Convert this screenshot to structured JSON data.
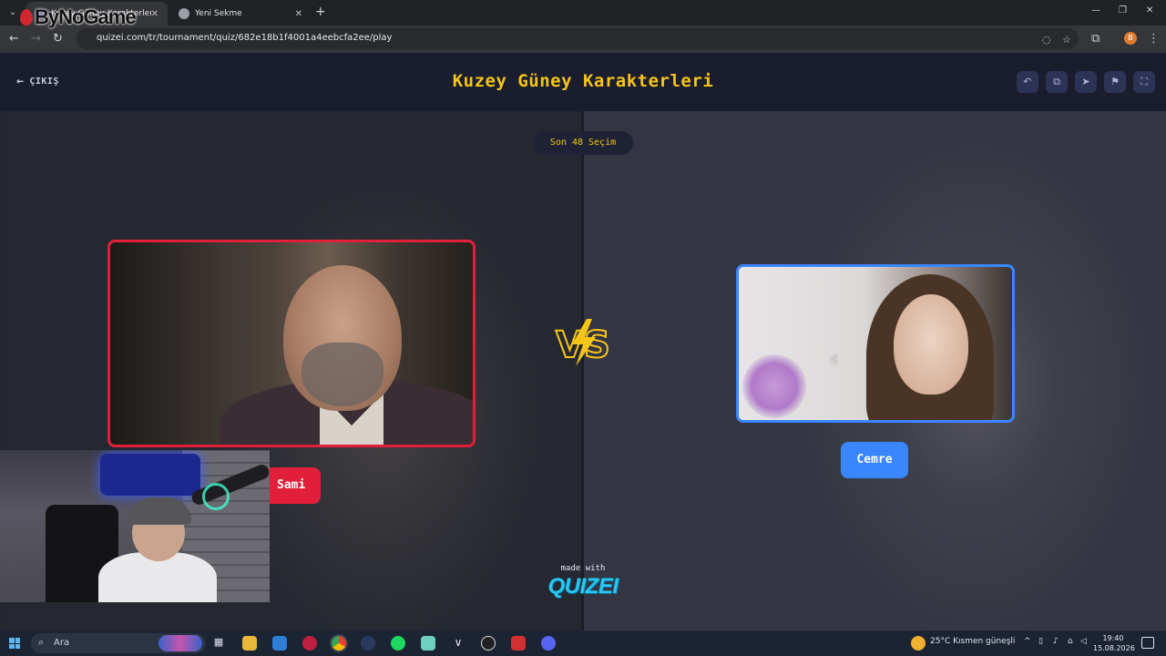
{
  "browser": {
    "tabs": [
      {
        "title": "Kuzey Güney Karakterleri - Tier",
        "active": true
      },
      {
        "title": "Yeni Sekme",
        "active": false
      }
    ],
    "url": "quizei.com/tr/tournament/quiz/682e18b1f4001a4eebcfa2ee/play",
    "profile_initial": "B"
  },
  "overlay": {
    "watermark": "ByNoGame"
  },
  "header": {
    "exit_label": "ÇIKIŞ",
    "title": "Kuzey Güney Karakterleri",
    "actions": [
      "undo-icon",
      "share-icon",
      "send-icon",
      "flag-icon",
      "fullscreen-icon"
    ]
  },
  "match": {
    "round_label": "Son 48 Seçim",
    "left": {
      "name": "Sami",
      "accent": "#e21f3a"
    },
    "right": {
      "name": "Cemre",
      "accent": "#3a86ff"
    },
    "vs_label": "VS"
  },
  "footer": {
    "made_with": "made with",
    "brand": "QUIZEI"
  },
  "taskbar": {
    "search_placeholder": "Ara",
    "weather": "25°C  Kısmen güneşli",
    "time": "19:40",
    "date": "15.08.2026"
  },
  "colors": {
    "title_yellow": "#f5c518",
    "header_bg": "#1a1d2e",
    "left_red": "#e21f3a",
    "right_blue": "#3a86ff"
  }
}
